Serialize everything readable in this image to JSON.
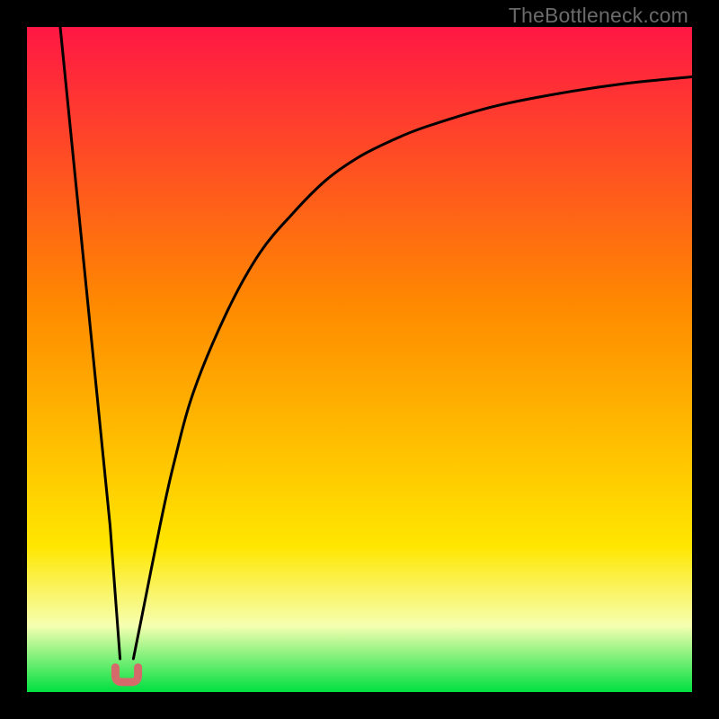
{
  "watermark": {
    "text": "TheBottleneck.com"
  },
  "colors": {
    "frame": "#000000",
    "curve": "#000000",
    "marker_fill": "#d46a6a",
    "marker_stroke": "#b94f4f",
    "gradient_top": "#ff1744",
    "gradient_orange": "#ff8a00",
    "gradient_yellow": "#ffe600",
    "gradient_pale": "#f6ffb0",
    "gradient_bottom": "#00e040"
  },
  "chart_data": {
    "type": "line",
    "title": "",
    "xlabel": "",
    "ylabel": "",
    "xlim": [
      0,
      100
    ],
    "ylim": [
      0,
      100
    ],
    "grid": false,
    "legend": false,
    "minimum_x": 15,
    "minimum_y": 0,
    "series": [
      {
        "name": "left-branch",
        "x": [
          5,
          7.5,
          10,
          12.5,
          14
        ],
        "values": [
          100,
          75,
          50,
          25,
          5
        ]
      },
      {
        "name": "right-branch",
        "x": [
          16,
          18,
          20,
          22,
          25,
          30,
          35,
          40,
          45,
          50,
          55,
          60,
          70,
          80,
          90,
          100
        ],
        "values": [
          5,
          15,
          25,
          34,
          45,
          57,
          66,
          72,
          77,
          80.5,
          83,
          85,
          88,
          90,
          91.5,
          92.5
        ]
      }
    ],
    "marker": {
      "name": "bottleneck-marker",
      "x_center": 15,
      "x_half_width": 1.7,
      "y": 1.5,
      "color": "#d46a6a"
    },
    "background_gradient_stops": [
      {
        "offset": 0.0,
        "color": "#ff1744"
      },
      {
        "offset": 0.42,
        "color": "#ff8a00"
      },
      {
        "offset": 0.78,
        "color": "#ffe600"
      },
      {
        "offset": 0.9,
        "color": "#f6ffb0"
      },
      {
        "offset": 1.0,
        "color": "#00e040"
      }
    ]
  }
}
